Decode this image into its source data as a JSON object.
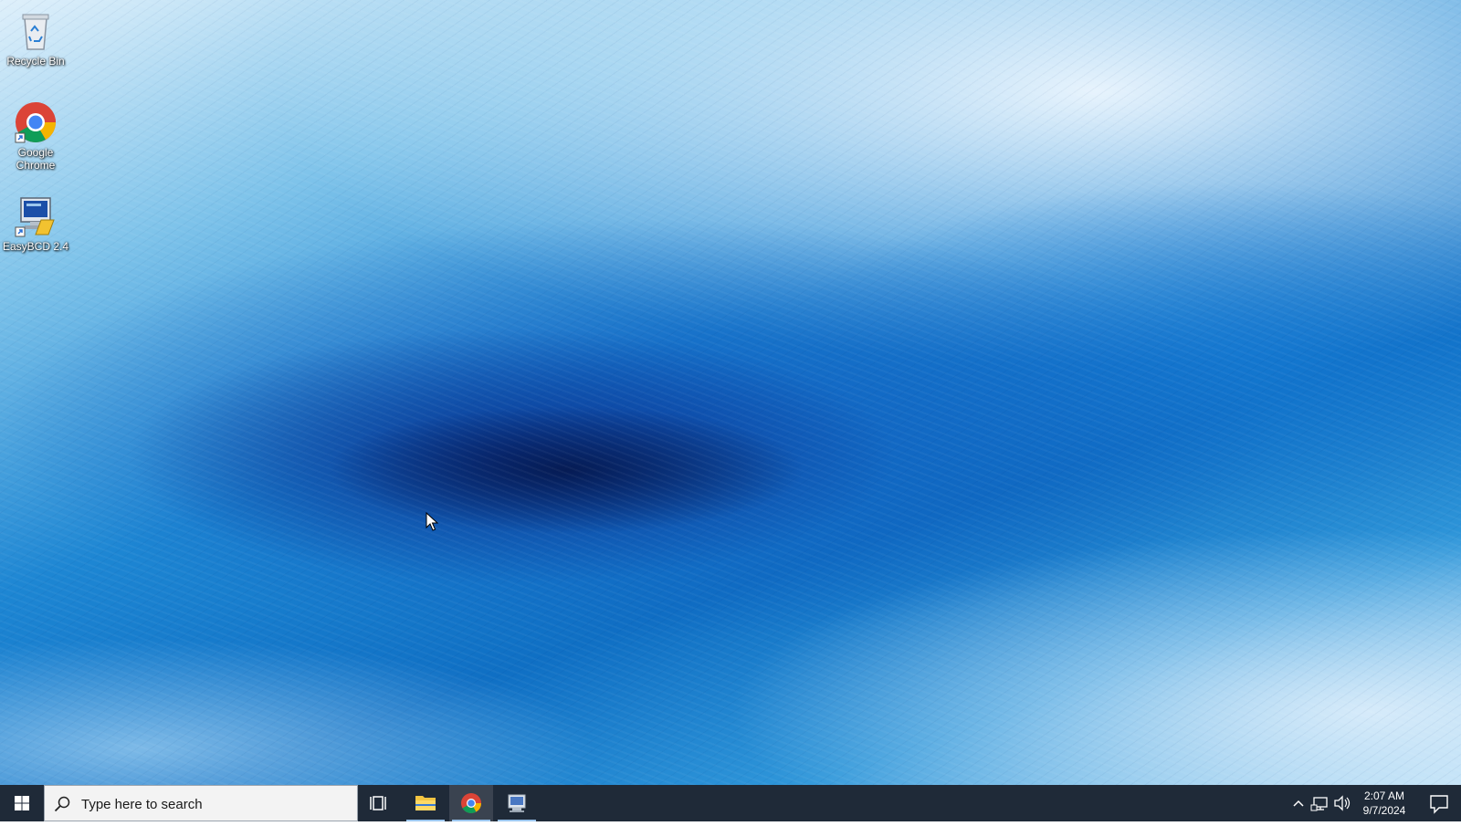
{
  "desktop": {
    "icons": [
      {
        "label": "Recycle Bin",
        "icon": "recycle-bin-icon"
      },
      {
        "label": "Google Chrome",
        "icon": "chrome-icon"
      },
      {
        "label": "EasyBCD 2.4",
        "icon": "easybcd-icon"
      }
    ],
    "wallpaper": "ice-cave-blue"
  },
  "taskbar": {
    "start_icon": "windows-logo-icon",
    "search": {
      "placeholder": "Type here to search",
      "icon": "search-icon"
    },
    "pinned": [
      {
        "name": "Task View",
        "icon": "task-view-icon",
        "active": false
      },
      {
        "name": "File Explorer",
        "icon": "folder-icon",
        "active": true
      },
      {
        "name": "Google Chrome",
        "icon": "chrome-icon",
        "active": true
      },
      {
        "name": "EasyBCD",
        "icon": "easybcd-icon",
        "active": true
      }
    ],
    "tray": {
      "icons": [
        "chevron-up-icon",
        "network-icon",
        "volume-icon"
      ],
      "time": "2:07 AM",
      "date": "9/7/2024",
      "notification_icon": "notification-icon"
    }
  },
  "colors": {
    "taskbar_bg": "#1f2a38",
    "accent": "#9cc6ee"
  }
}
